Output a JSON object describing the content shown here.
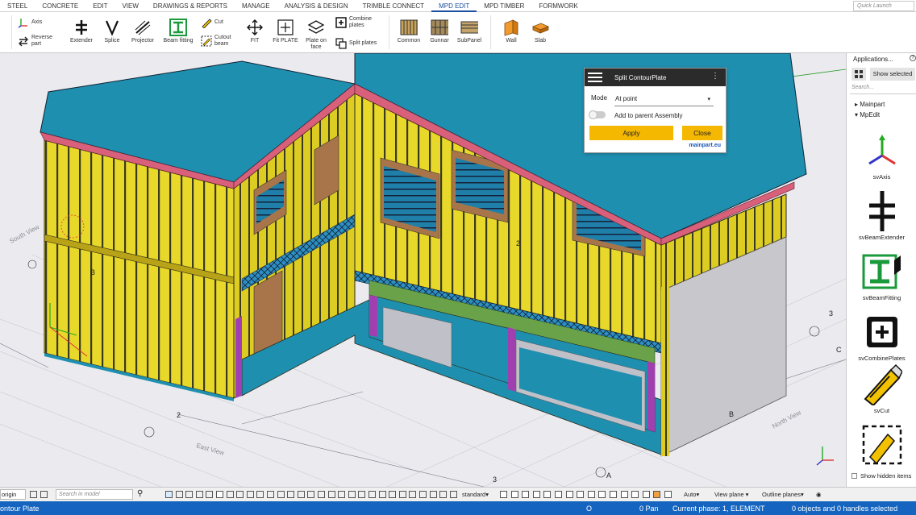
{
  "menu": {
    "tabs": [
      "STEEL",
      "CONCRETE",
      "EDIT",
      "VIEW",
      "DRAWINGS & REPORTS",
      "MANAGE",
      "ANALYSIS & DESIGN",
      "TRIMBLE CONNECT",
      "MPD EDIT",
      "MPD TIMBER",
      "FORMWORK"
    ],
    "active_tab": "MPD EDIT",
    "quick_launch_placeholder": "Quick Launch"
  },
  "ribbon": {
    "axis": "Axis",
    "reverse_part": "Reverse part",
    "extender": "Extender",
    "splice": "Splice",
    "projector": "Projector",
    "beam_fitting": "Beam fitting",
    "cut": "Cut",
    "cutout_beam": "Cutout beam",
    "fit": "FIT",
    "fit_plate": "Fit PLATE",
    "plate_on_face": "Plate on face",
    "combine_plates": "Combine plates",
    "split_plates": "Split plates",
    "common": "Common",
    "gunnar": "Gunnar",
    "subpanel": "SubPanel",
    "wall": "Wall",
    "slab": "Slab"
  },
  "dialog": {
    "title": "Split ContourPlate",
    "mode_label": "Mode",
    "mode_value": "At point",
    "add_to_parent": "Add to parent Assembly",
    "apply": "Apply",
    "close": "Close",
    "brand": "mainpart.eu"
  },
  "viewport": {
    "grid_labels": [
      "B",
      "2",
      "2",
      "3",
      "3",
      "C",
      "B",
      "A"
    ],
    "view_labels": [
      "South View",
      "East View",
      "North View"
    ]
  },
  "right_panel": {
    "title": "Applications...",
    "show_selected": "Show selected",
    "search_placeholder": "Search...",
    "tree": [
      "Mainpart",
      "MpEdit"
    ],
    "tools": [
      "svAxis",
      "svBeamExtender",
      "svBeamFitting",
      "svCombinePlates",
      "svCut",
      ""
    ],
    "show_hidden": "Show hidden items"
  },
  "bottom_toolbar": {
    "origin": "origin",
    "search_placeholder": "Search in model",
    "standard": "standard",
    "auto": "Auto",
    "view_plane": "View plane",
    "outline_planes": "Outline planes"
  },
  "status": {
    "left": "ontour Plate",
    "o": "O",
    "pan": "0 Pan",
    "phase": "Current phase: 1, ELEMENT",
    "objects": "0 objects and 0 handles selected"
  },
  "colors": {
    "accent": "#1565c0",
    "stud_yellow": "#e8d82a",
    "roof_blue": "#1f8fb0",
    "fascia_red": "#d8607a",
    "apply_button": "#f5b800"
  }
}
